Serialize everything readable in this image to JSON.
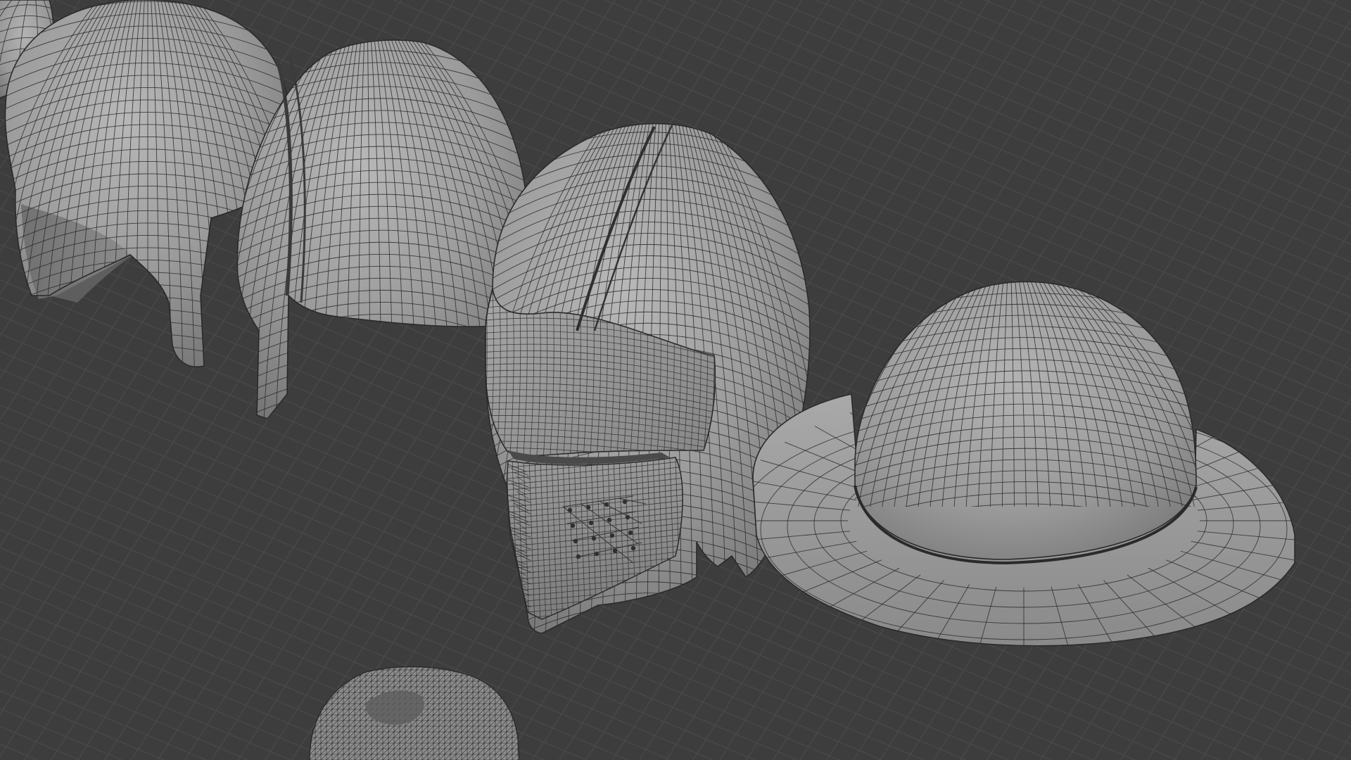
{
  "app": {
    "name": "",
    "view": "3D Viewport"
  },
  "viewport": {
    "background": "#3d3d3d",
    "grid_color": "#4a4a4a",
    "grid_floor": true,
    "shading": "solid",
    "wireframe_overlay": true
  },
  "colors": {
    "mesh_fill": "#9a9a9a",
    "mesh_highlight": "#b4b4b4",
    "mesh_shadow": "#6c6c6c",
    "wire": "#2a2a2a",
    "dark_interior": "#5a5a5a"
  },
  "objects": [
    {
      "name": "helmet-partial-left",
      "kind": "open-face-helmet"
    },
    {
      "name": "helmet-open-face",
      "kind": "open-face-helmet-with-cheek-guards"
    },
    {
      "name": "helmet-nasal",
      "kind": "nasal-helmet"
    },
    {
      "name": "helmet-closed-visor",
      "kind": "closed-helmet-with-visor"
    },
    {
      "name": "helmet-kettle-hat",
      "kind": "kettle-hat"
    },
    {
      "name": "sculpt-mesh",
      "kind": "high-density-triangulated-mesh"
    }
  ]
}
